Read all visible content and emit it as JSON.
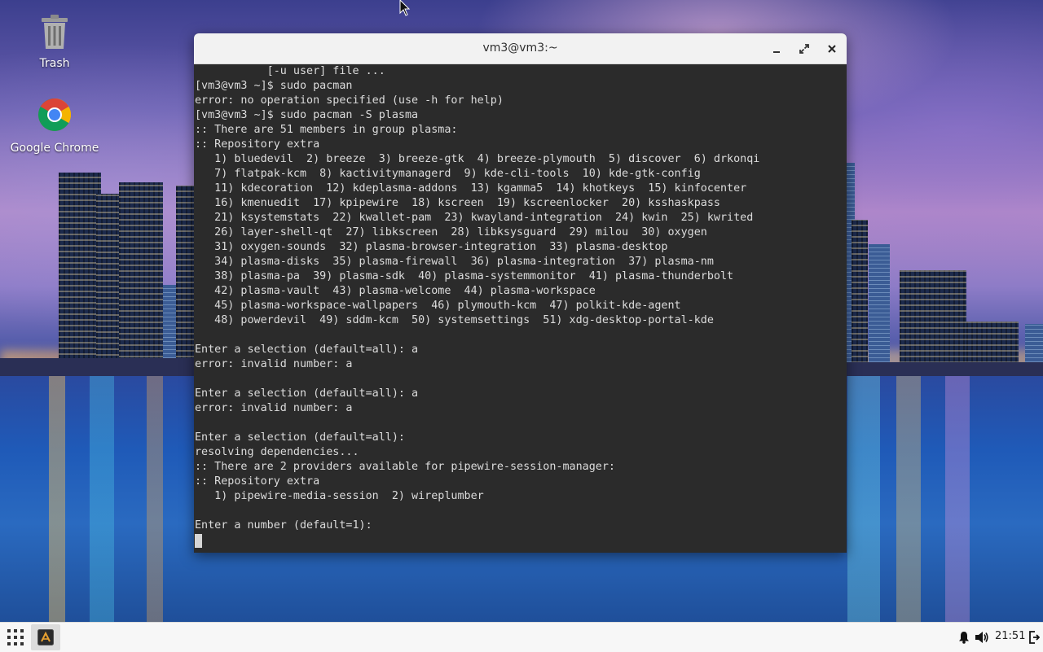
{
  "desktop": {
    "icons": [
      {
        "label": "Trash",
        "icon": "trash-icon"
      },
      {
        "label": "Google Chrome",
        "icon": "chrome-icon"
      }
    ]
  },
  "terminal": {
    "title": "vm3@vm3:~",
    "controls": [
      "minimize-icon",
      "maximize-icon",
      "close-icon"
    ],
    "lines": [
      "           [-u user] file ...",
      "[vm3@vm3 ~]$ sudo pacman",
      "error: no operation specified (use -h for help)",
      "[vm3@vm3 ~]$ sudo pacman -S plasma",
      ":: There are 51 members in group plasma:",
      ":: Repository extra",
      "   1) bluedevil  2) breeze  3) breeze-gtk  4) breeze-plymouth  5) discover  6) drkonqi",
      "   7) flatpak-kcm  8) kactivitymanagerd  9) kde-cli-tools  10) kde-gtk-config",
      "   11) kdecoration  12) kdeplasma-addons  13) kgamma5  14) khotkeys  15) kinfocenter",
      "   16) kmenuedit  17) kpipewire  18) kscreen  19) kscreenlocker  20) ksshaskpass",
      "   21) ksystemstats  22) kwallet-pam  23) kwayland-integration  24) kwin  25) kwrited",
      "   26) layer-shell-qt  27) libkscreen  28) libksysguard  29) milou  30) oxygen",
      "   31) oxygen-sounds  32) plasma-browser-integration  33) plasma-desktop",
      "   34) plasma-disks  35) plasma-firewall  36) plasma-integration  37) plasma-nm",
      "   38) plasma-pa  39) plasma-sdk  40) plasma-systemmonitor  41) plasma-thunderbolt",
      "   42) plasma-vault  43) plasma-welcome  44) plasma-workspace",
      "   45) plasma-workspace-wallpapers  46) plymouth-kcm  47) polkit-kde-agent",
      "   48) powerdevil  49) sddm-kcm  50) systemsettings  51) xdg-desktop-portal-kde",
      "",
      "Enter a selection (default=all): a",
      "error: invalid number: a",
      "",
      "Enter a selection (default=all): a",
      "error: invalid number: a",
      "",
      "Enter a selection (default=all):",
      "resolving dependencies...",
      ":: There are 2 providers available for pipewire-session-manager:",
      ":: Repository extra",
      "   1) pipewire-media-session  2) wireplumber",
      "",
      "Enter a number (default=1):"
    ]
  },
  "taskbar": {
    "launcher_icon": "app-grid-icon",
    "task_icon": "terminal-app-icon",
    "tray_icons": [
      "bell-icon",
      "volume-icon",
      "logout-icon"
    ],
    "clock": "21:51"
  },
  "colors": {
    "terminal_bg": "#2b2b2b",
    "terminal_fg": "#dcdcdc",
    "titlebar_bg": "#f2f2f2",
    "taskbar_bg": "#f7f7f7"
  }
}
